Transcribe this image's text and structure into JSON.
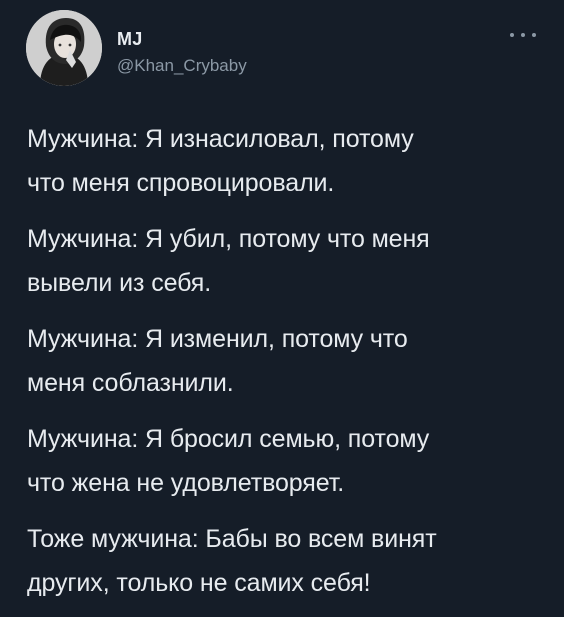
{
  "tweet": {
    "author": {
      "display_name": "MJ",
      "handle": "@Khan_Crybaby",
      "avatar_icon": "profile-photo"
    },
    "more_icon": "more-options-icon",
    "paragraphs": [
      {
        "lines": [
          "Мужчина: Я изнасиловал, потому",
          "что меня спровоцировали."
        ]
      },
      {
        "lines": [
          "Мужчина: Я убил, потому что меня",
          "вывели из себя."
        ]
      },
      {
        "lines": [
          "Мужчина: Я изменил, потому что",
          "меня соблазнили."
        ]
      },
      {
        "lines": [
          "Мужчина: Я бросил семью, потому",
          "что жена не удовлетворяет."
        ]
      },
      {
        "lines": [
          "Тоже мужчина: Бабы во всем винят",
          "других, только не самих себя!"
        ]
      }
    ]
  },
  "colors": {
    "background": "#151d28",
    "text": "#e7ebef",
    "secondary_text": "#8b98a5"
  }
}
